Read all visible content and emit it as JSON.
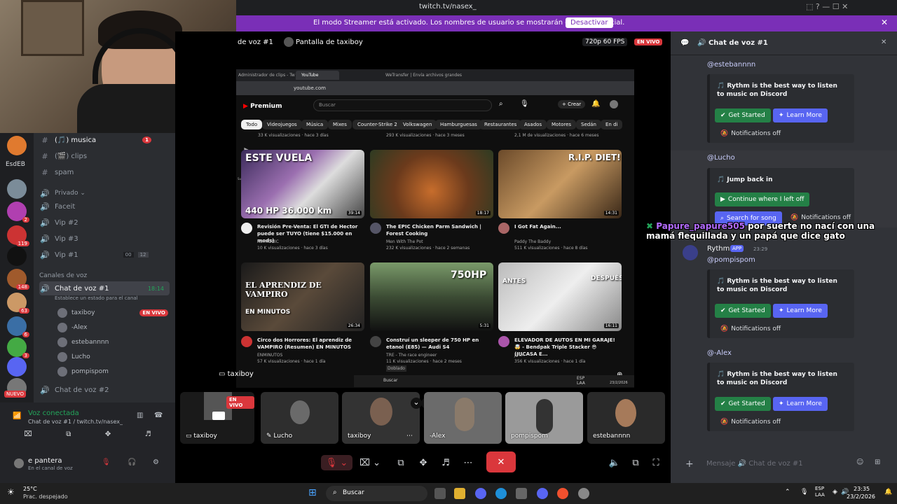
{
  "browser_bar": {
    "url": "twitch.tv/nasex_"
  },
  "streamer_banner": {
    "message": "El modo Streamer está activado. Los nombres de usuario se mostrarán de forma parcial.",
    "button": "Desactivar"
  },
  "channels": {
    "items": [
      {
        "icon": "#",
        "label": "(🎵) musica",
        "badge": "1"
      },
      {
        "icon": "#",
        "label": "(🎬) clips"
      },
      {
        "icon": "#",
        "label": "spam"
      },
      {
        "icon": "🔊",
        "label": "Privado ⌄"
      },
      {
        "icon": "🔊",
        "label": "Faceit"
      },
      {
        "icon": "🔊",
        "label": "Vip #2"
      },
      {
        "icon": "🔊",
        "label": "Vip #3"
      },
      {
        "icon": "🔊",
        "label": "Vip #1",
        "counter": "00",
        "limit": "12"
      }
    ],
    "voice_header": "Canales de voz",
    "active_channel": "Chat de voz #1",
    "active_time": "18:14",
    "status_prompt": "Establece un estado para el canal",
    "voice_users": [
      "taxiboy",
      "-Alex",
      "estebannnn",
      "Lucho",
      "pompispom"
    ],
    "live_label": "EN VIVO",
    "next_channel": "Chat de voz #2",
    "guild_label": "EsdEB",
    "new_label": "NUEVO"
  },
  "voice_panel": {
    "status": "Voz conectada",
    "location": "Chat de voz #1 / twitch.tv/nasex_",
    "user": "e pantera",
    "user_sub": "En el canal de voz"
  },
  "stage": {
    "header_left": "de voz #1",
    "header_screen": "Pantalla de taxiboy",
    "quality": "720p 60 FPS",
    "live": "EN VIVO",
    "share_label": "taxiboy"
  },
  "youtube": {
    "tab1": "Administrador de clips - Tw",
    "tab2": "YouTube",
    "tab3": "WeTransfer | Envía archivos grandes",
    "address": "youtube.com",
    "logo": "Premium",
    "search_placeholder": "Buscar",
    "create": "Crear",
    "chips": [
      "Todo",
      "Videojuegos",
      "Música",
      "Mixes",
      "Counter-Strike 2",
      "Volkswagen",
      "Hamburguesas",
      "Restaurantes",
      "Asados",
      "Motores",
      "Sedán",
      "En di"
    ],
    "top_meta": [
      "33 K visualizaciones · hace 3 días",
      "293 K visualizaciones · hace 3 meses",
      "2,1 M de visualizaciones · hace 6 meses"
    ],
    "sidebar": [
      "Shorts",
      "Suscripciones",
      "Tú"
    ],
    "videos": [
      {
        "title": "Revisión Pre-Venta: El GTI de Hector puede ser TUYO (tiene $15.000 en mods)",
        "channel": "RSTRONIC",
        "meta": "10 K visualizaciones · hace 3 días",
        "duration": "39:14",
        "thumb_text": "ESTE VUELA",
        "thumb_text2": "440 HP 36.000 km"
      },
      {
        "title": "The EPIC Chicken Parm Sandwich | Forest Cooking",
        "channel": "Men With The Pot",
        "meta": "232 K visualizaciones · hace 2 semanas",
        "duration": "18:17"
      },
      {
        "title": "I Got Fat Again...",
        "channel": "Paddy The Baddy",
        "meta": "511 K visualizaciones · hace 8 días",
        "duration": "14:31",
        "thumb_text": "R.I.P. DIET!"
      },
      {
        "title": "Circo dos Horrores: El aprendiz de VAMPIRO (Resumen) EN MINUTOS",
        "channel": "ENMINUTOS",
        "meta": "57 K visualizaciones · hace 1 día",
        "duration": "26:34",
        "thumb_text": "EL APRENDIZ DE VAMPIRO",
        "thumb_text2": "EN MINUTOS"
      },
      {
        "title": "Construí un sleeper de 750 HP en etanol (E85) — Audi S4",
        "channel": "TRE - The race engineer",
        "meta": "11 K visualizaciones · hace 2 meses",
        "duration": "5:31",
        "thumb_text": "750HP",
        "extra": "Doblado"
      },
      {
        "title": "ELEVADOR DE AUTOS EN MI GARAJE! 🤯 - Bendpak Triple Stacker 😎 (JUCASA E...",
        "channel": "JUCA",
        "meta": "356 K visualizaciones · hace 1 día",
        "duration": "16:11",
        "thumb_text": "ANTES",
        "thumb_text2": "DESPUÉS"
      }
    ],
    "taskbar_search": "Buscar",
    "taskbar_lang": "ESP LAA",
    "taskbar_date": "23/2/2026"
  },
  "tiles": [
    {
      "name": "taxiboy",
      "live": "EN VIVO"
    },
    {
      "name": "Lucho"
    },
    {
      "name": "taxiboy"
    },
    {
      "name": "-Alex"
    },
    {
      "name": "pompispom"
    },
    {
      "name": "estebannnn"
    }
  ],
  "chat": {
    "title": "Chat de voz #1",
    "messages": [
      {
        "mention": "@estebannnn",
        "text": "Rythm is the best way to listen to music on Discord",
        "b1": "Get Started",
        "b2": "Learn More",
        "off": "Notifications off"
      },
      {
        "mention": "@Lucho",
        "text": "Jump back in",
        "b1": "Continue where I left off",
        "b2": "Search for song",
        "off": "Notifications off"
      },
      {
        "mention": "@pompispom",
        "text": "Rythm is the best way to listen to music on Discord",
        "b1": "Get Started",
        "b2": "Learn More",
        "off": "Notifications off"
      },
      {
        "mention": "@-Alex",
        "text": "Rythm is the best way to listen to music on Discord",
        "b1": "Get Started",
        "b2": "Learn More",
        "off": "Notifications off"
      }
    ],
    "bot_name": "Rythm",
    "bot_tag": "APP",
    "bot_time": "23:29",
    "input_placeholder": "Mensaje 🔊 Chat de voz #1"
  },
  "overlay": {
    "user": "Papure_papure505",
    "text": "por suerte no nací con una mamá flequillada y un papá que dice gato"
  },
  "taskbar": {
    "weather": "25°C",
    "weather_sub": "Prac. despejado",
    "search": "Buscar",
    "lang": "ESP LAA",
    "time": "23:35",
    "date": "23/2/2026"
  }
}
